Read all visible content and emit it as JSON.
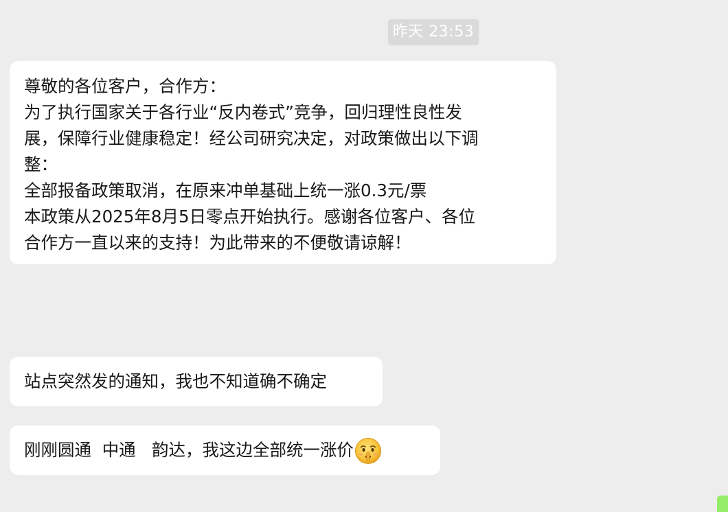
{
  "chat": {
    "timestamp": "昨天 23:53",
    "messages": [
      {
        "lines": [
          "尊敬的各位客户，合作方：",
          "为了执行国家关于各行业“反内卷式”竞争，回归理性良性发",
          "展，保障行业健康稳定！经公司研究决定，对政策做出以下调",
          "整：",
          "全部报备政策取消，在原来冲单基础上统一涨0.3元/票",
          "本政策从2025年8月5日零点开始执行。感谢各位客户、各位",
          "合作方一直以来的支持！为此带来的不便敬请谅解！"
        ]
      },
      {
        "text": "站点突然发的通知，我也不知道确不确定"
      },
      {
        "text": "刚刚圆通  中通   韵达，我这边全部统一涨价",
        "emoji": "shushing-face-emoji"
      }
    ]
  },
  "colors": {
    "background": "#ededed",
    "bubble": "#ffffff",
    "text": "#191919",
    "timestamp_bg": "#dadada",
    "outgoing_bubble": "#95ec69"
  }
}
